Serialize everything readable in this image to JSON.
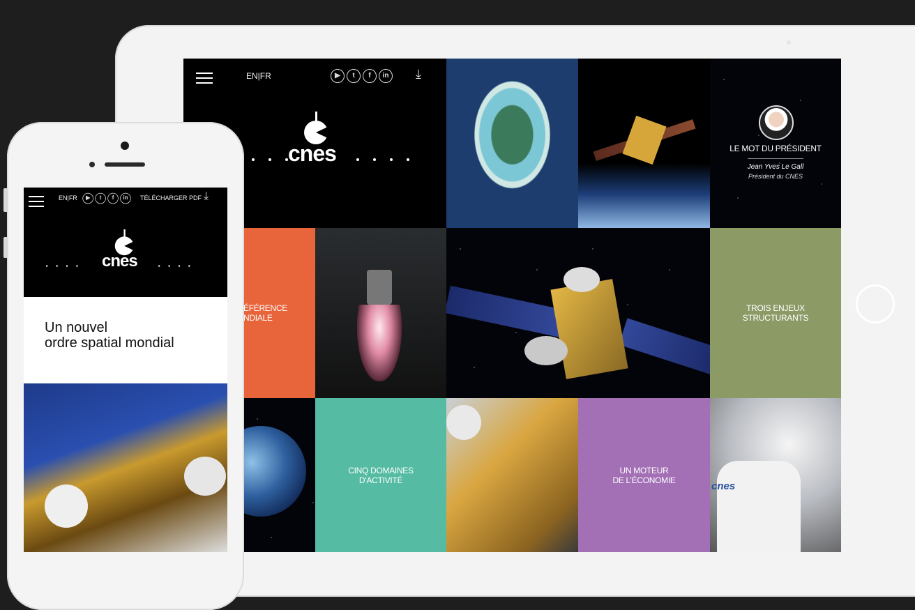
{
  "tablet": {
    "lang": "EN|FR",
    "social_icons": [
      "youtube-icon",
      "twitter-icon",
      "facebook-icon",
      "linkedin-icon"
    ],
    "logo_text": "cnes",
    "president": {
      "title": "LE MOT DU PRÉSIDENT",
      "name": "Jean Yves Le Gall",
      "role": "Président du CNES"
    },
    "tiles": {
      "reference": "ÉFÉRENCE\nNDIALE",
      "trois_enjeux": "TROIS ENJEUX\nSTRUCTURANTS",
      "cinq_domaines": "CINQ DOMAINES\nD’ACTIVITÉ",
      "moteur": "UN MOTEUR\nDE L’ÉCONOMIE"
    },
    "colors": {
      "orange": "#e8643a",
      "green": "#8c9a66",
      "teal": "#55bba3",
      "purple": "#a370b6"
    }
  },
  "phone": {
    "lang": "EN|FR",
    "download_label": "TÉLÉCHARGER PDF",
    "logo_text": "cnes",
    "headline_1": "Un nouvel",
    "headline_2": "ordre spatial mondial"
  }
}
